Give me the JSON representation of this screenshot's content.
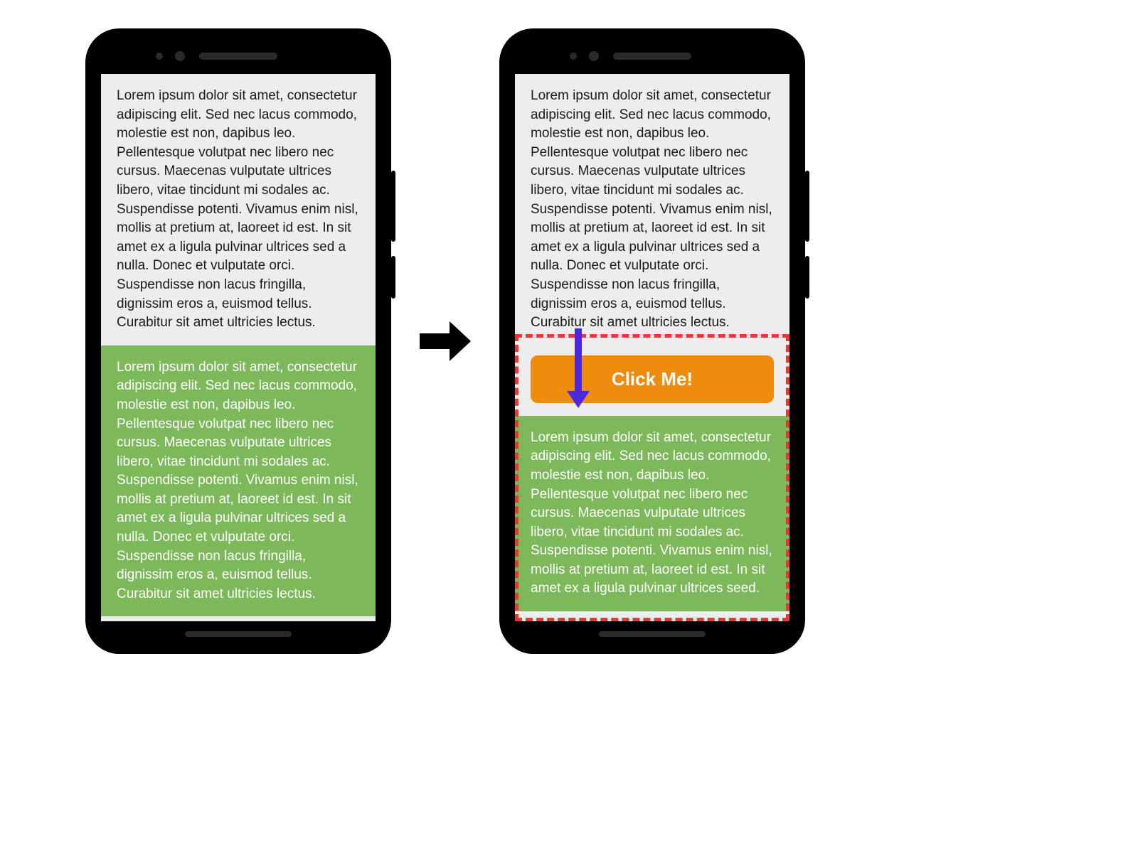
{
  "phones": {
    "left": {
      "top_text": "Lorem ipsum dolor sit amet, consectetur adipiscing elit. Sed nec lacus commodo, molestie est non, dapibus leo. Pellentesque volutpat nec libero nec cursus. Maecenas vulputate ultrices libero, vitae tincidunt mi sodales ac. Suspendisse potenti. Vivamus enim nisl, mollis at pretium at, laoreet id est. In sit amet ex a ligula pulvinar ultrices sed a nulla. Donec et vulputate orci. Suspendisse non lacus fringilla, dignissim eros a, euismod tellus. Curabitur sit amet ultricies lectus.",
      "bottom_text": "Lorem ipsum dolor sit amet, consectetur adipiscing elit. Sed nec lacus commodo, molestie est non, dapibus leo. Pellentesque volutpat nec libero nec cursus. Maecenas vulputate ultrices libero, vitae tincidunt mi sodales ac. Suspendisse potenti. Vivamus enim nisl, mollis at pretium at, laoreet id est. In sit amet ex a ligula pulvinar ultrices sed a nulla. Donec et vulputate orci. Suspendisse non lacus fringilla, dignissim eros a, euismod tellus. Curabitur sit amet ultricies lectus."
    },
    "right": {
      "top_text": "Lorem ipsum dolor sit amet, consectetur adipiscing elit. Sed nec lacus commodo, molestie est non, dapibus leo. Pellentesque volutpat nec libero nec cursus. Maecenas vulputate ultrices libero, vitae tincidunt mi sodales ac. Suspendisse potenti. Vivamus enim nisl, mollis at pretium at, laoreet id est. In sit amet ex a ligula pulvinar ultrices sed a nulla. Donec et vulputate orci. Suspendisse non lacus fringilla, dignissim eros a, euismod tellus. Curabitur sit amet ultricies lectus.",
      "button_label": "Click Me!",
      "bottom_text": "Lorem ipsum dolor sit amet, consectetur adipiscing elit. Sed nec lacus commodo, molestie est non, dapibus leo. Pellentesque volutpat nec libero nec cursus. Maecenas vulputate ultrices libero, vitae tincidunt mi sodales ac. Suspendisse potenti. Vivamus enim nisl, mollis at pretium at, laoreet id est. In sit amet ex a ligula pulvinar ultrices seed."
    }
  },
  "colors": {
    "green": "#7db95b",
    "orange": "#ef8c0e",
    "highlight_border": "#e53935",
    "arrow_purple": "#4a29e0"
  }
}
